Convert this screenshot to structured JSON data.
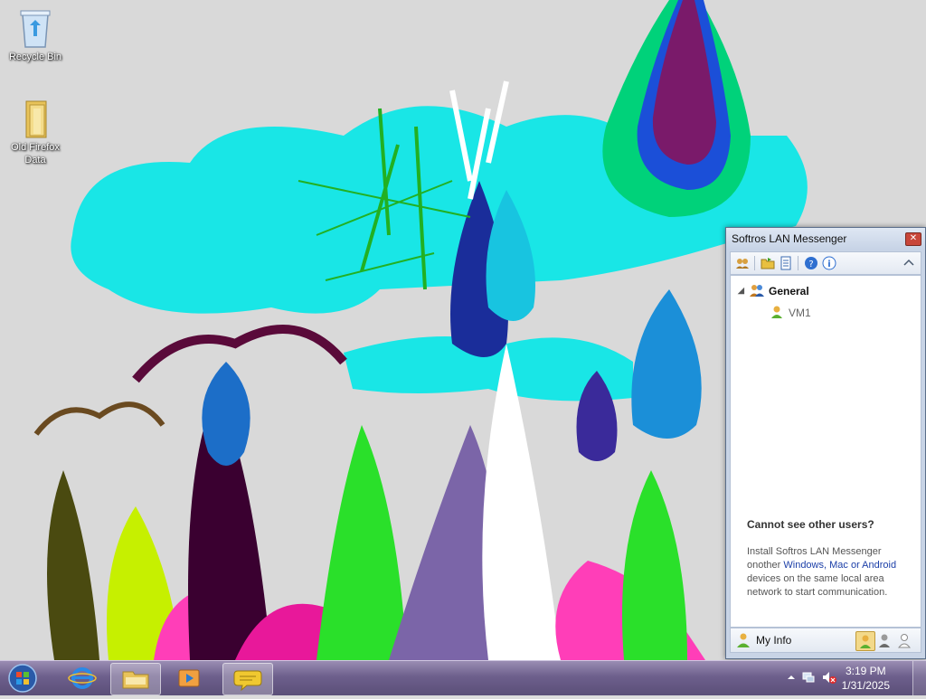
{
  "desktop": {
    "icons": [
      {
        "label": "Recycle Bin"
      },
      {
        "label": "Old Firefox Data"
      }
    ]
  },
  "messenger": {
    "title": "Softros LAN Messenger",
    "close_glyph": "✕",
    "toolbar_icons": [
      "users-options-icon",
      "open-folder-icon",
      "history-book-icon",
      "help-icon",
      "info-icon",
      "collapse-chevron-icon"
    ],
    "tree": {
      "expand_glyph": "◢",
      "group": "General",
      "users": [
        "VM1"
      ]
    },
    "help": {
      "title": "Cannot see other users?",
      "text_before": "Install Softros LAN Messenger onother ",
      "link": "Windows, Mac or Android",
      "text_after": " devices on the same local area network to start communication."
    },
    "status": {
      "my_info": "My Info",
      "states": [
        "available",
        "away",
        "offline"
      ],
      "selected": "available"
    }
  },
  "taskbar": {
    "pinned": [
      "internet-explorer",
      "windows-explorer",
      "media-player",
      "lan-messenger"
    ],
    "active": "lan-messenger",
    "clock": {
      "time": "3:19 PM",
      "date": "1/31/2025"
    },
    "tray_icons": [
      "show-hidden-icons-arrow",
      "network-icon",
      "volume-muted-icon"
    ]
  },
  "colors": {
    "accent_link": "#1c3fa8",
    "taskbar": "#6d5f8c"
  }
}
